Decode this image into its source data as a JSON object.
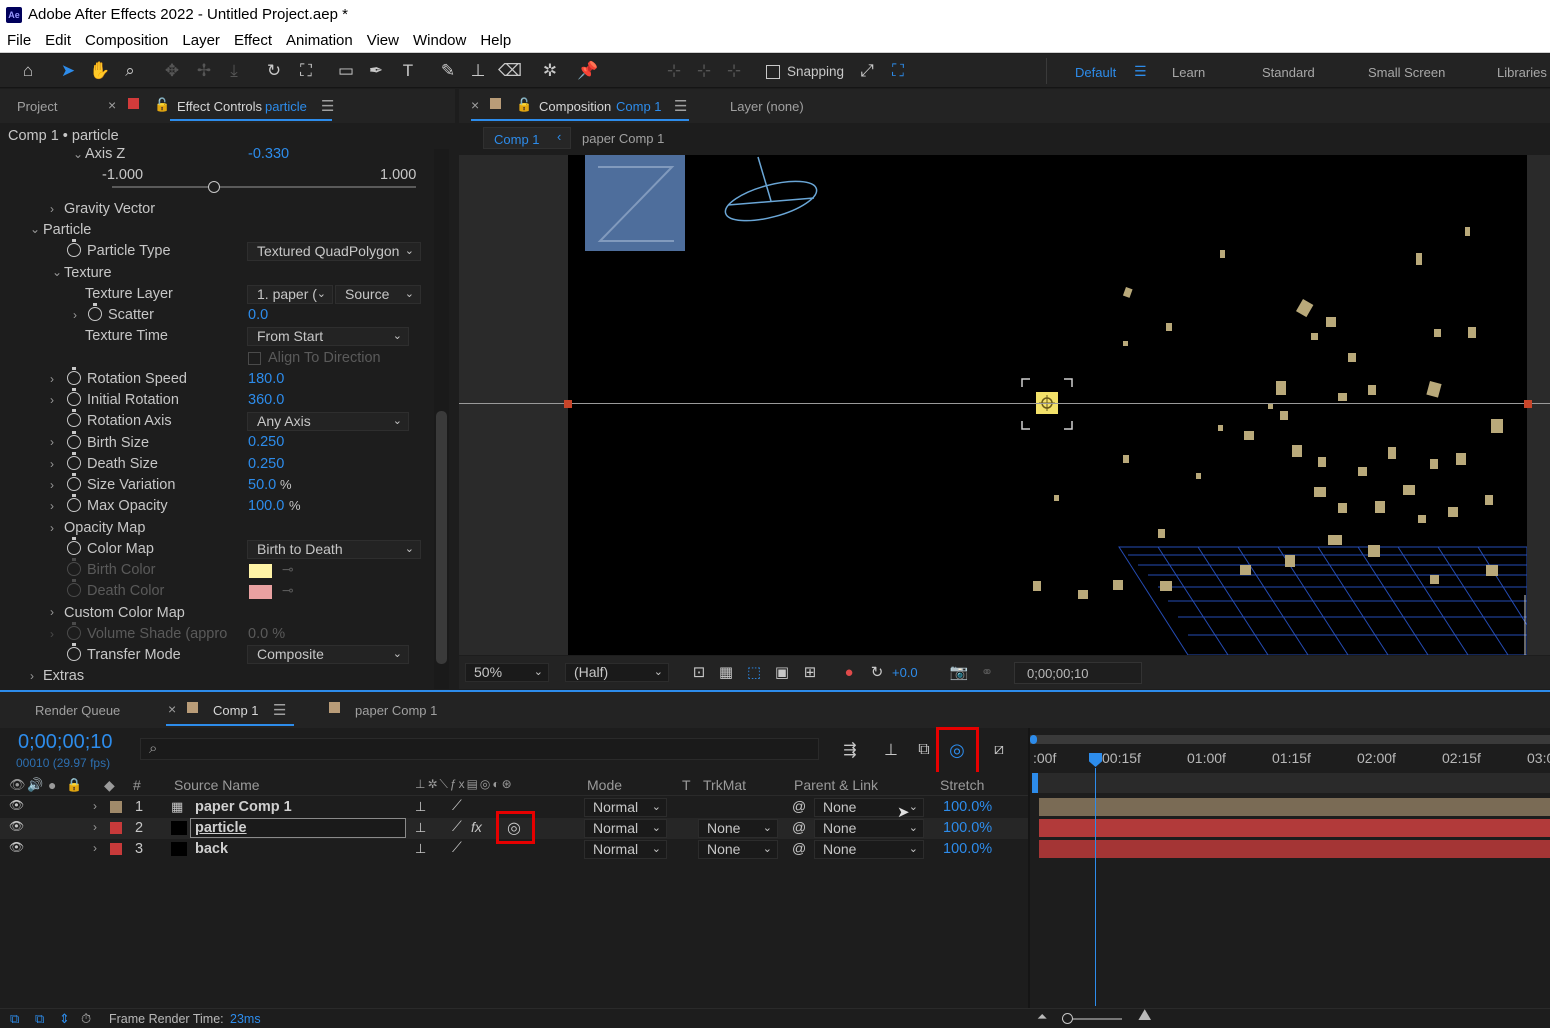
{
  "window": {
    "app_badge": "Ae",
    "title": "Adobe After Effects 2022 - Untitled Project.aep *"
  },
  "menu": [
    "File",
    "Edit",
    "Composition",
    "Layer",
    "Effect",
    "Animation",
    "View",
    "Window",
    "Help"
  ],
  "toolbar": {
    "snapping_label": "Snapping",
    "workspaces": [
      "Default",
      "Learn",
      "Standard",
      "Small Screen",
      "Libraries"
    ],
    "active_workspace": "Default"
  },
  "left_panel": {
    "tab_project": "Project",
    "tab_effect_controls": "Effect Controls",
    "tab_effect_controls_layer": "particle",
    "breadcrumb": "Comp 1 • particle",
    "axis_z": {
      "label": "Axis Z",
      "value": "-0.330",
      "min": "-1.000",
      "max": "1.000",
      "slider_fraction": 0.335
    },
    "properties": [
      {
        "label": "Gravity Vector"
      },
      {
        "label": "Particle"
      },
      {
        "label": "Particle Type",
        "dropdown": "Textured QuadPolygon"
      },
      {
        "label": "Texture"
      },
      {
        "label": "Texture Layer",
        "dropdown": "1. paper (",
        "dropdown2": "Source"
      },
      {
        "label": "Scatter",
        "value": "0.0"
      },
      {
        "label": "Texture Time",
        "dropdown": "From Start"
      },
      {
        "label": "Align To Direction"
      },
      {
        "label": "Rotation Speed",
        "value": "180.0"
      },
      {
        "label": "Initial Rotation",
        "value": "360.0"
      },
      {
        "label": "Rotation Axis",
        "dropdown": "Any Axis"
      },
      {
        "label": "Birth Size",
        "value": "0.250"
      },
      {
        "label": "Death Size",
        "value": "0.250"
      },
      {
        "label": "Size Variation",
        "value": "50.0",
        "unit": "%"
      },
      {
        "label": "Max Opacity",
        "value": "100.0",
        "unit": "%"
      },
      {
        "label": "Opacity Map"
      },
      {
        "label": "Color Map",
        "dropdown": "Birth to Death"
      },
      {
        "label": "Birth Color",
        "color": "#fff3a6"
      },
      {
        "label": "Death Color",
        "color": "#e9a1a1"
      },
      {
        "label": "Custom Color Map"
      },
      {
        "label": "Volume Shade (appro",
        "value": "0.0",
        "unit": "%"
      },
      {
        "label": "Transfer Mode",
        "dropdown": "Composite"
      },
      {
        "label": "Extras"
      }
    ]
  },
  "comp_panel": {
    "tab_prefix": "Composition",
    "tab_comp": "Comp 1",
    "layer_tab": "Layer (none)",
    "flow_active": "Comp 1",
    "flow_next": "paper Comp 1",
    "footer": {
      "zoom": "50%",
      "resolution": "(Half)",
      "exposure": "+0.0",
      "timecode": "0;00;00;10"
    }
  },
  "timeline": {
    "tab_render_queue": "Render Queue",
    "tab_comp1": "Comp 1",
    "tab_paper": "paper Comp 1",
    "timecode": "0;00;00;10",
    "fps": "00010 (29.97 fps)",
    "columns": {
      "num": "#",
      "source": "Source Name",
      "mode": "Mode",
      "t": "T",
      "trkmat": "TrkMat",
      "parent": "Parent & Link",
      "stretch": "Stretch"
    },
    "ruler": [
      ":00f",
      "00:15f",
      "01:00f",
      "01:15f",
      "02:00f",
      "02:15f",
      "03:0"
    ],
    "layers": [
      {
        "num": "1",
        "name": "paper Comp 1",
        "label_color": "#a08a6a",
        "mode": "Normal",
        "trkmat": "",
        "parent": "None",
        "stretch": "100.0%",
        "bar_color": "#7a6b55"
      },
      {
        "num": "2",
        "name": "particle",
        "label_color": "#c73a3a",
        "mode": "Normal",
        "trkmat": "None",
        "parent": "None",
        "stretch": "100.0%",
        "bar_color": "#b23a3a"
      },
      {
        "num": "3",
        "name": "back",
        "label_color": "#c73a3a",
        "mode": "Normal",
        "trkmat": "None",
        "parent": "None",
        "stretch": "100.0%",
        "bar_color": "#a43535"
      }
    ],
    "status_label": "Frame Render Time:",
    "status_value": "23ms"
  },
  "colors": {
    "accent": "#2d8ceb",
    "highlight_box": "#e60000",
    "panel_bg": "#1d1d1d"
  }
}
